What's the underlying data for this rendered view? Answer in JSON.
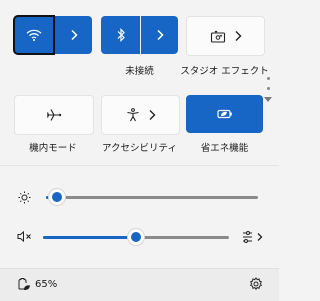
{
  "tiles_row1": {
    "wifi": {
      "icon": "wifi-icon",
      "state": "on"
    },
    "bluetooth": {
      "icon": "bluetooth-icon",
      "state": "on",
      "label": "未接続"
    },
    "studio_effects": {
      "icon": "studio-effects-icon",
      "label": "スタジオ エフェクト"
    }
  },
  "tiles_row2": {
    "airplane": {
      "icon": "airplane-icon",
      "label": "機内モード"
    },
    "accessibility": {
      "icon": "accessibility-icon",
      "label": "アクセシビリティ"
    },
    "energy_saver": {
      "icon": "energy-saver-icon",
      "label": "省エネ機能",
      "state": "on"
    }
  },
  "brightness": {
    "icon": "brightness-icon",
    "level_percent": 5
  },
  "volume": {
    "icon": "speaker-muted-icon",
    "level_percent": 50,
    "output_icon": "audio-output-icon"
  },
  "footer": {
    "battery_icon": "battery-saver-icon",
    "battery_percent": "65%",
    "settings_icon": "gear-icon"
  },
  "colors": {
    "accent": "#1766c5",
    "panel_bg": "#f3f3f3",
    "footer_bg": "#ececec"
  }
}
